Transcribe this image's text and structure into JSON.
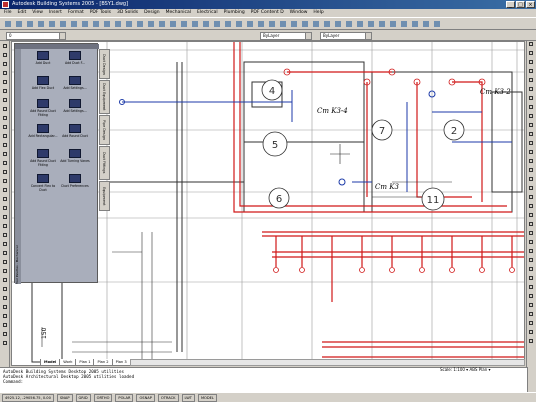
{
  "window": {
    "title": "Autodesk Building Systems 2005 - [BSY1.dwg]",
    "controls": [
      "_",
      "□",
      "×"
    ]
  },
  "menu": [
    "File",
    "Edit",
    "View",
    "Insert",
    "Format",
    "PDF Tools",
    "3D Solids",
    "Design",
    "Mechanical",
    "Electrical",
    "Plumbing",
    "PDF Content D",
    "Window",
    "Help"
  ],
  "toolbar": {
    "layer_combo": "0",
    "color_combo": "ByLayer",
    "linetype_combo": "ByLayer"
  },
  "palette": {
    "tools": [
      {
        "label": "Add Duct"
      },
      {
        "label": "Add Duct F..."
      },
      {
        "label": "Add Flex Duct"
      },
      {
        "label": "Add Settings..."
      },
      {
        "label": "Add Round Duct Fitting"
      },
      {
        "label": "Add Settings..."
      },
      {
        "label": "Add Rectangular..."
      },
      {
        "label": "Add Round Duct"
      },
      {
        "label": "Add Round Duct Fitting"
      },
      {
        "label": "Add Turning Vanes"
      },
      {
        "label": "Convert Flex to Duct"
      },
      {
        "label": "Duct Preferences"
      }
    ],
    "tabs": [
      "Duct Design",
      "Duct Equipment",
      "Pipe Design",
      "Duct Fittings",
      "Equipment"
    ],
    "side_label": "Tool Palettes - Mechanical"
  },
  "drawing": {
    "tags": [
      "4",
      "5",
      "6",
      "7",
      "2",
      "11"
    ],
    "annotations": [
      "Cm K3-4",
      "Cm K3-2",
      "Cm K3"
    ],
    "dimension": "150"
  },
  "layout_tabs": [
    "Model",
    "Work",
    "Plan 1",
    "Plan 2",
    "Plan 3"
  ],
  "command_line": [
    "AutoDesk Building Systems Desktop 2005 utilities",
    "AutoDesk Architectural Desktop 2005 utilities loaded",
    "Command:"
  ],
  "scale_info": "Scale: 1:100 ▾  ABS Plan ▾",
  "status": {
    "coords": "4925.12, -29056.75, 0.00",
    "toggles": [
      "SNAP",
      "GRID",
      "ORTHO",
      "POLAR",
      "OSNAP",
      "OTRACK",
      "LWT",
      "MODEL"
    ]
  },
  "colors": {
    "titlebar": "#0a246a",
    "duct_red": "#d01818",
    "duct_blue": "#1c3aa8",
    "palette": "#a9aebb"
  }
}
